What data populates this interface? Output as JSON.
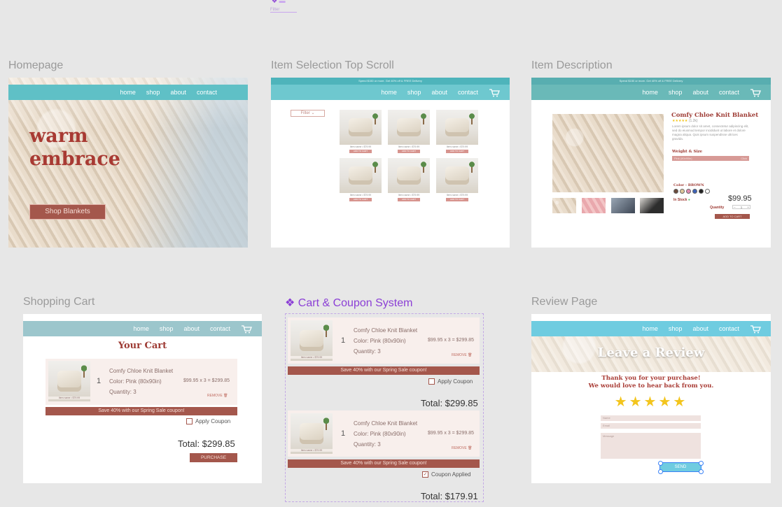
{
  "top_fragment": {
    "filter_label": "Filter"
  },
  "nav": {
    "home": "home",
    "shop": "shop",
    "about": "about",
    "contact": "contact"
  },
  "promo_text": "Spend $150 or more. Get 40% off & FREE Delivery",
  "frames": {
    "homepage": {
      "title": "Homepage",
      "headline_line1": "warm",
      "headline_line2": "embrace",
      "cta": "Shop Blankets"
    },
    "item_selection": {
      "title": "Item Selection Top Scroll",
      "filter_label": "Filter",
      "caption": "Item name • $79.99",
      "add_label": "ADD TO CART"
    },
    "item_description": {
      "title": "Item Description",
      "product_name": "Comfy Chloe Knit Blanket",
      "rating_text": "(1.2k)",
      "description": "Lorem ipsum dolor sit amet, consectetur adipiscing elit, sed do eiusmod tempor incididunt ut labore et dolore magna aliqua. Quis ipsum suspendisse ultrices gravida.",
      "weight_size_label": "Weight & Size",
      "size_value": "Pink (80x90in)",
      "size_dropdown": "Click",
      "color_label": "Color - BROWN",
      "in_stock": "In Stock",
      "price": "$99.95",
      "quantity_label": "Quantity",
      "quantity_value": "1",
      "add_to_cart": "ADD TO CART",
      "swatches": [
        "#6b4a3c",
        "#e0c89a",
        "#e28cb0",
        "#3e63b8",
        "#222222",
        "#ffffff"
      ]
    },
    "shopping_cart": {
      "title": "Shopping Cart",
      "heading": "Your Cart",
      "qty": "1",
      "item_name": "Comfy Chloe Knit Blanket",
      "item_color": "Color: Pink (80x90in)",
      "item_quantity": "Quantity: 3",
      "price_calc": "$99.95 x 3 = $299.85",
      "remove": "REMOVE",
      "coupon_banner": "Save 40% with our Spring Sale coupon!",
      "apply_coupon": "Apply Coupon",
      "total": "Total: $299.85",
      "purchase": "PURCHASE",
      "thumb_caption": "Item name • $79.99"
    },
    "cart_coupon": {
      "title": "Cart & Coupon System",
      "variant1": {
        "coupon_label": "Apply Coupon",
        "total": "Total: $299.85"
      },
      "variant2": {
        "coupon_label": "Coupon Applied",
        "total": "Total: $179.91"
      }
    },
    "review": {
      "title": "Review Page",
      "heading": "Leave a Review",
      "thanks_line1": "Thank you for your purchase!",
      "thanks_line2": "We would love to hear back from you.",
      "stars": 5,
      "name_placeholder": "Name",
      "email_placeholder": "Email",
      "message_placeholder": "Message",
      "send": "SEND"
    }
  },
  "colors": {
    "nav_teal": "#5fc0c6",
    "brand_red": "#a4574c",
    "star": "#f3c51d",
    "component_purple": "#8b3fd6"
  }
}
